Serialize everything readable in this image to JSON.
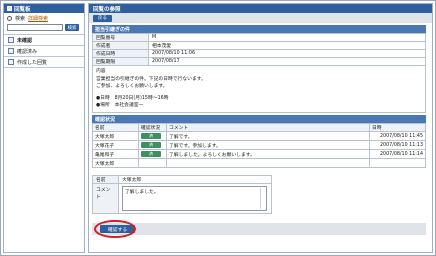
{
  "sidebar": {
    "title": "回覧板",
    "search_label": "検索",
    "advanced_search": "詳細検索",
    "search_button": "検索",
    "items": [
      {
        "label": "未確認"
      },
      {
        "label": "確認済み"
      },
      {
        "label": "作成した回覧"
      }
    ]
  },
  "main": {
    "title": "回覧の参照",
    "back_button": "戻る"
  },
  "article": {
    "section_title": "担当引継ぎの件",
    "fields": [
      {
        "label": "回覧番号",
        "value": "M"
      },
      {
        "label": "作成者",
        "value": "相本茂愛"
      },
      {
        "label": "作成日時",
        "value": "2007/08/10 11:06"
      },
      {
        "label": "回覧期限",
        "value": "2007/08/17"
      }
    ],
    "body_label": "内容",
    "body_lines": [
      "営業担当の引継ぎの件。下記の日時で行ないます。",
      "ご参加、よろしくお願いします。",
      "",
      "●日時　8月20日(月)15時～16時",
      "●場所　本社会議室一"
    ]
  },
  "responses": {
    "section_title": "確認状況",
    "headers": {
      "name": "名前",
      "status": "確認状況",
      "comment": "コメント",
      "datetime": "日時"
    },
    "rows": [
      {
        "name": "大塚太郎",
        "status": "済",
        "comment": "了解です。",
        "datetime": "2007/08/10 11:45"
      },
      {
        "name": "大塚花子",
        "status": "済",
        "comment": "了解です。参加します。",
        "datetime": "2007/08/10 11:13"
      },
      {
        "name": "亀尾和子",
        "status": "済",
        "comment": "了解しました。よろしくお願いします。",
        "datetime": "2007/08/10 11:14"
      },
      {
        "name": "大塚太郎",
        "status": "",
        "comment": "",
        "datetime": ""
      }
    ]
  },
  "reply": {
    "name_label": "名前",
    "name_value": "大塚太郎",
    "comment_label": "コメント",
    "comment_value": "了解しました。",
    "confirm_button": "確認する"
  },
  "colors": {
    "header_blue": "#2f5f9e",
    "badge_green": "#3f8f63",
    "highlight_red": "#d41f1f"
  }
}
